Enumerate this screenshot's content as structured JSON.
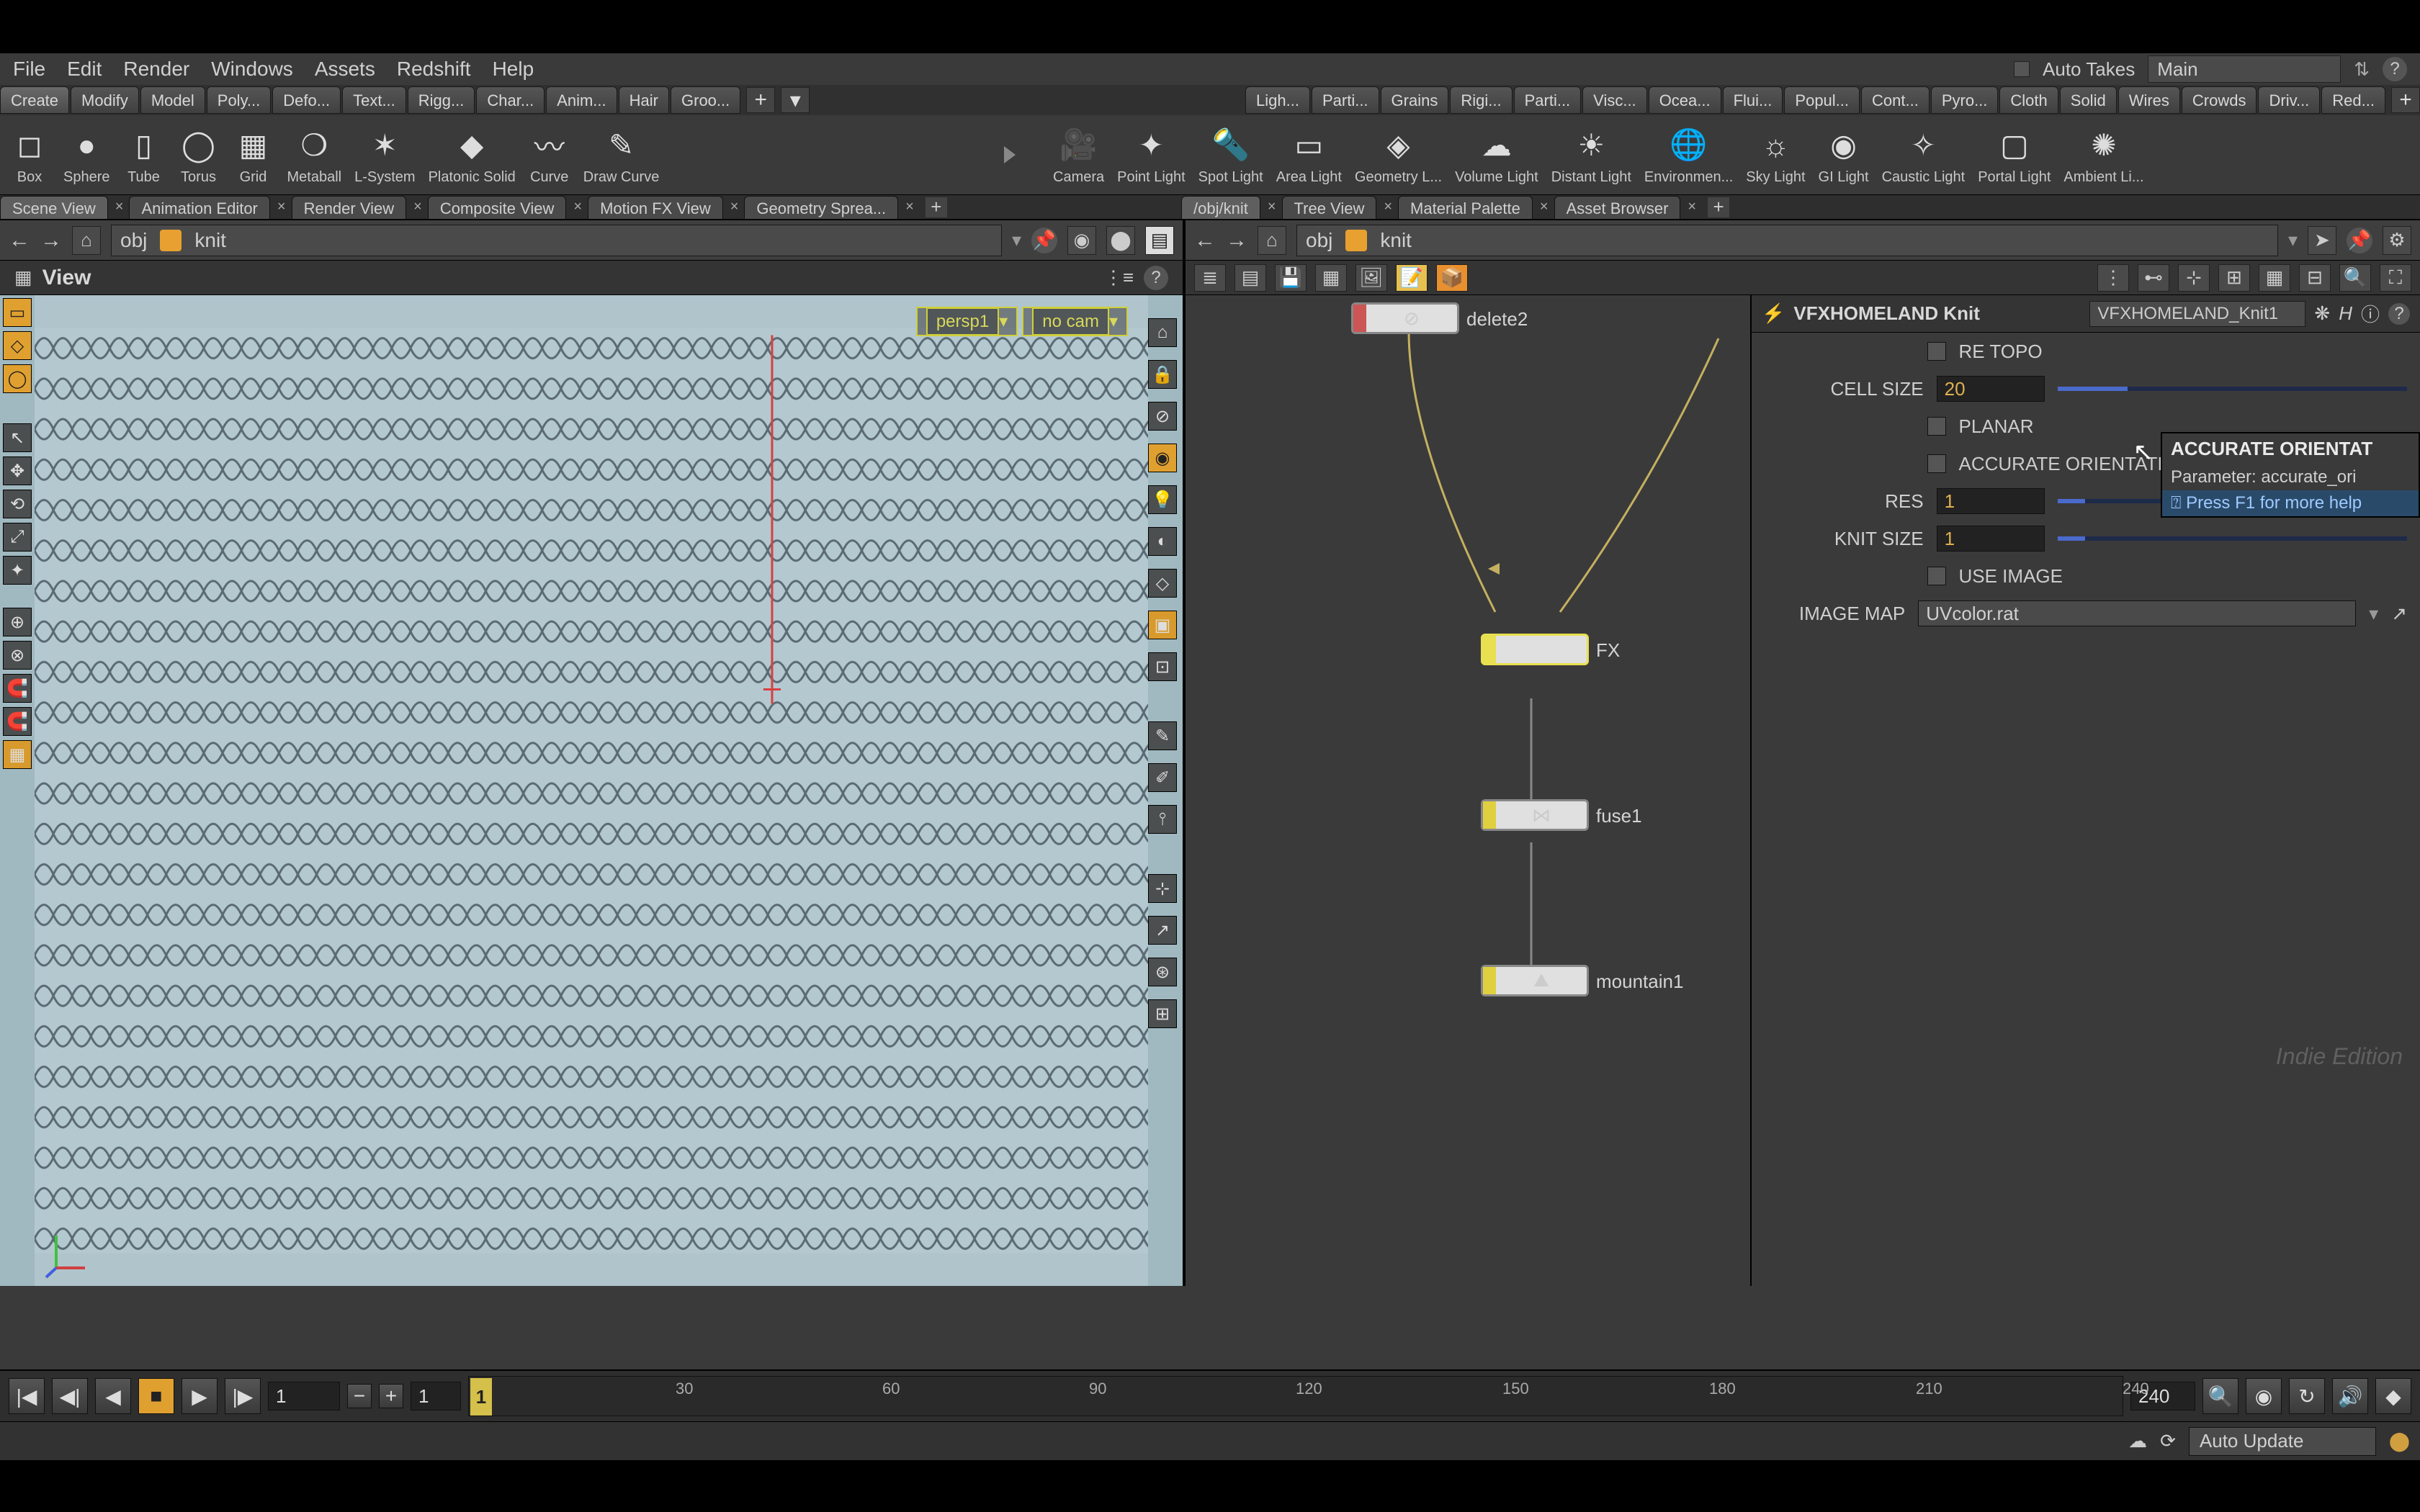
{
  "menu": {
    "items": [
      "File",
      "Edit",
      "Render",
      "Windows",
      "Assets",
      "Redshift",
      "Help"
    ],
    "auto_takes": "Auto Takes",
    "take_dd": "Main"
  },
  "shelvesL": [
    "Create",
    "Modify",
    "Model",
    "Poly...",
    "Defo...",
    "Text...",
    "Rigg...",
    "Char...",
    "Anim...",
    "Hair",
    "Groo..."
  ],
  "shelvesR": [
    "Ligh...",
    "Parti...",
    "Grains",
    "Rigi...",
    "Parti...",
    "Visc...",
    "Ocea...",
    "Flui...",
    "Popul...",
    "Cont...",
    "Pyro...",
    "Cloth",
    "Solid",
    "Wires",
    "Crowds",
    "Driv...",
    "Red..."
  ],
  "toolsL": [
    {
      "n": "Box",
      "g": "◻"
    },
    {
      "n": "Sphere",
      "g": "●"
    },
    {
      "n": "Tube",
      "g": "▯"
    },
    {
      "n": "Torus",
      "g": "◯"
    },
    {
      "n": "Grid",
      "g": "▦"
    },
    {
      "n": "Metaball",
      "g": "❍"
    },
    {
      "n": "L-System",
      "g": "✶"
    },
    {
      "n": "Platonic Solid",
      "g": "◆"
    },
    {
      "n": "Curve",
      "g": "〰"
    },
    {
      "n": "Draw Curve",
      "g": "✎"
    }
  ],
  "toolsR": [
    {
      "n": "Camera",
      "g": "🎥"
    },
    {
      "n": "Point Light",
      "g": "✦"
    },
    {
      "n": "Spot Light",
      "g": "🔦"
    },
    {
      "n": "Area Light",
      "g": "▭"
    },
    {
      "n": "Geometry L...",
      "g": "◈"
    },
    {
      "n": "Volume Light",
      "g": "☁"
    },
    {
      "n": "Distant Light",
      "g": "☀"
    },
    {
      "n": "Environmen...",
      "g": "🌐"
    },
    {
      "n": "Sky Light",
      "g": "☼"
    },
    {
      "n": "GI Light",
      "g": "◉"
    },
    {
      "n": "Caustic Light",
      "g": "✧"
    },
    {
      "n": "Portal Light",
      "g": "▢"
    },
    {
      "n": "Ambient Li...",
      "g": "✺"
    }
  ],
  "paneTabsL": [
    "Scene View",
    "Animation Editor",
    "Render View",
    "Composite View",
    "Motion FX View",
    "Geometry Sprea..."
  ],
  "paneTabsR": [
    "/obj/knit",
    "Tree View",
    "Material Palette",
    "Asset Browser"
  ],
  "path": {
    "scope": "obj",
    "node": "knit"
  },
  "view": {
    "title": "View",
    "cam": "persp1",
    "nocam": "no cam",
    "stats": ""
  },
  "nodes": {
    "delete2": "delete2",
    "knit": "FX",
    "fuse1": "fuse1",
    "mountain1": "mountain1"
  },
  "params": {
    "asset": "VFXHOMELAND Knit",
    "opname": "VFXHOMELAND_Knit1",
    "retopo": "RE TOPO",
    "cellsize_l": "CELL SIZE",
    "cellsize_v": "20",
    "planar": "PLANAR",
    "accurate": "ACCURATE ORIENTATION",
    "res_l": "RES",
    "res_v": "1",
    "knit_l": "KNIT SIZE",
    "knit_v": "1",
    "useimg": "USE IMAGE",
    "imgmap_l": "IMAGE MAP",
    "imgmap_v": "UVcolor.rat"
  },
  "tooltip": {
    "title": "ACCURATE ORIENTAT",
    "body": "Parameter: accurate_ori",
    "foot": "⍰ Press F1 for more help"
  },
  "timeline": {
    "start": "1",
    "startR": "1",
    "end": "240",
    "ticks": [
      30,
      60,
      90,
      120,
      150,
      180,
      210,
      240
    ],
    "cursor": "1"
  },
  "status": {
    "auto": "Auto Update"
  },
  "watermark": "Indie Edition"
}
